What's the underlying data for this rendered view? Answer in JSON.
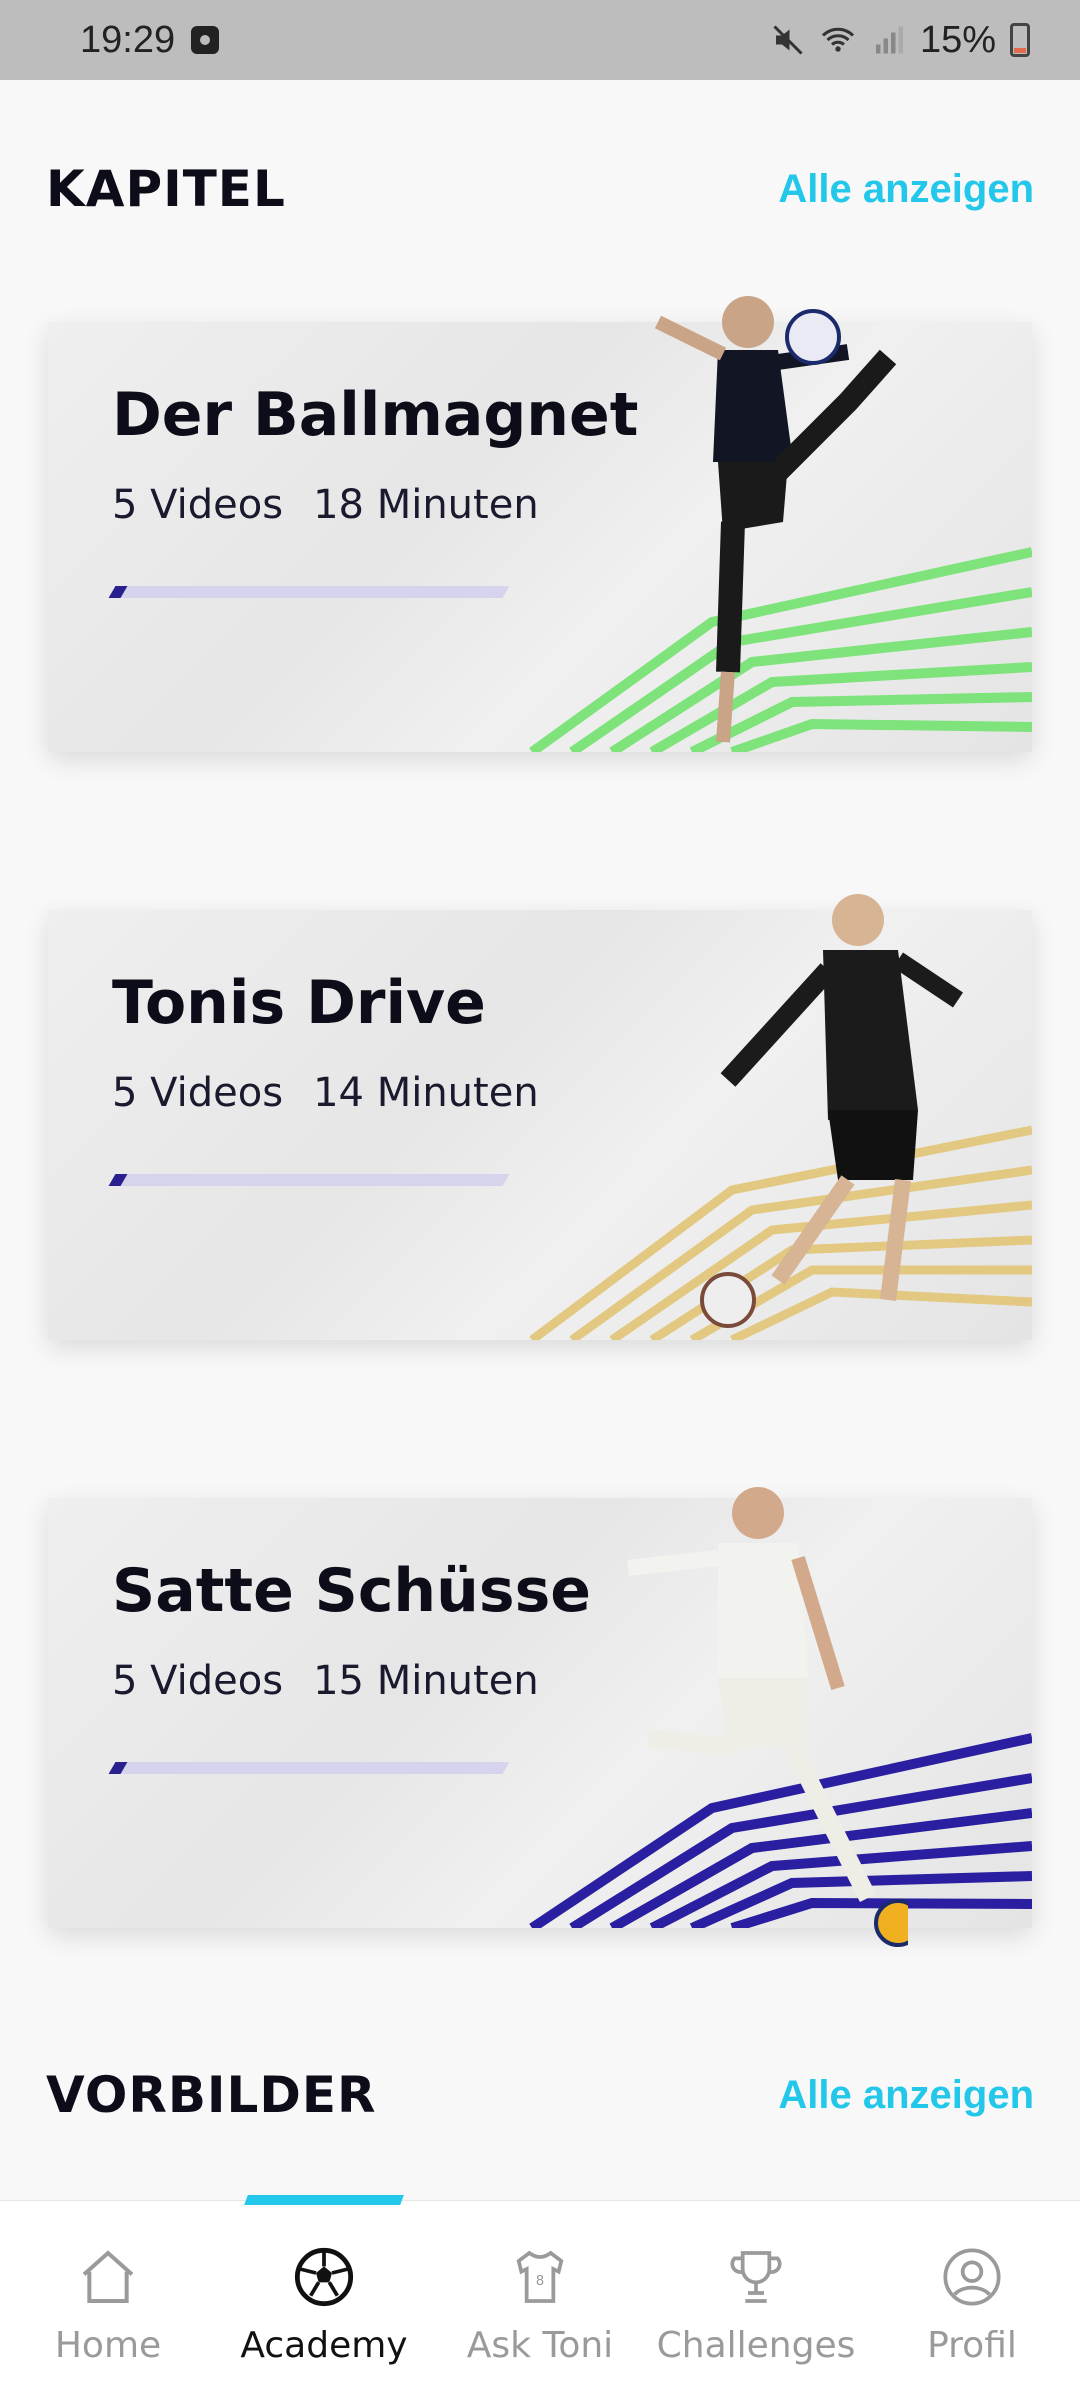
{
  "status_bar": {
    "time": "19:29",
    "battery": "15%"
  },
  "sections": {
    "kapitel": {
      "title": "KAPITEL",
      "link": "Alle anzeigen"
    },
    "vorbilder": {
      "title": "VORBILDER",
      "link": "Alle anzeigen"
    }
  },
  "cards": [
    {
      "title": "Der Ballmagnet",
      "videos": "5 Videos",
      "minutes": "18 Minuten",
      "accent": "#7ee37a",
      "progress": 0.03
    },
    {
      "title": "Tonis Drive",
      "videos": "5 Videos",
      "minutes": "14 Minuten",
      "accent": "#e2c880",
      "progress": 0.03
    },
    {
      "title": "Satte Schüsse",
      "videos": "5 Videos",
      "minutes": "15 Minuten",
      "accent": "#2a1fa0",
      "progress": 0.03
    }
  ],
  "bottom_nav": {
    "items": [
      {
        "label": "Home",
        "icon": "home-icon"
      },
      {
        "label": "Academy",
        "icon": "soccer-ball-icon"
      },
      {
        "label": "Ask Toni",
        "icon": "jersey-icon"
      },
      {
        "label": "Challenges",
        "icon": "trophy-icon"
      },
      {
        "label": "Profil",
        "icon": "profile-icon"
      }
    ],
    "active_index": 1
  },
  "colors": {
    "accent": "#22c7ea",
    "text": "#0d0d1a",
    "progress": "#2a1f8f"
  }
}
